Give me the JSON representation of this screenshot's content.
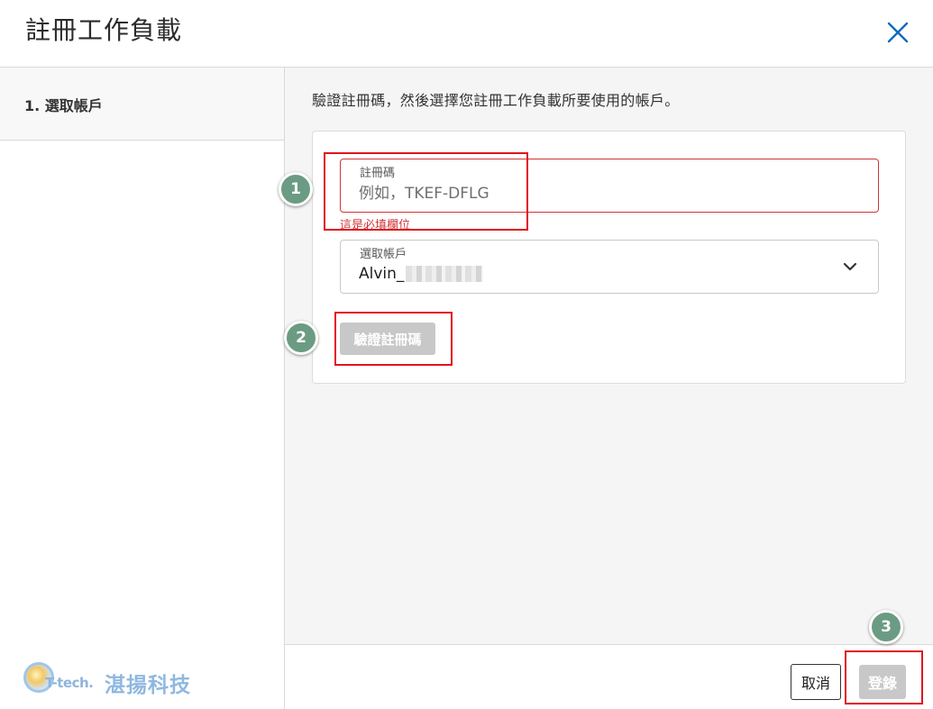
{
  "dialog": {
    "title": "註冊工作負載",
    "close_icon": "close-icon"
  },
  "sidebar": {
    "steps": [
      {
        "label": "1. 選取帳戶"
      }
    ]
  },
  "main": {
    "instruction": "驗證註冊碼，然後選擇您註冊工作負載所要使用的帳戶。",
    "registration_code": {
      "label": "註冊碼",
      "placeholder": "例如，TKEF-DFLG",
      "value": "",
      "error": "這是必填欄位"
    },
    "account_select": {
      "label": "選取帳戶",
      "value": "Alvin_"
    },
    "verify_button": "驗證註冊碼"
  },
  "footer": {
    "cancel_button": "取消",
    "register_button": "登錄"
  },
  "annotations": {
    "badges": [
      "1",
      "2",
      "3"
    ],
    "highlight_color": "#e0141e",
    "badge_color": "#6b9c83"
  },
  "watermark": {
    "brand": "T-tech.",
    "company": "湛揚科技"
  },
  "colors": {
    "accent": "#0f6cbd",
    "error": "#d13438",
    "disabled_button": "#c8c8c8"
  }
}
